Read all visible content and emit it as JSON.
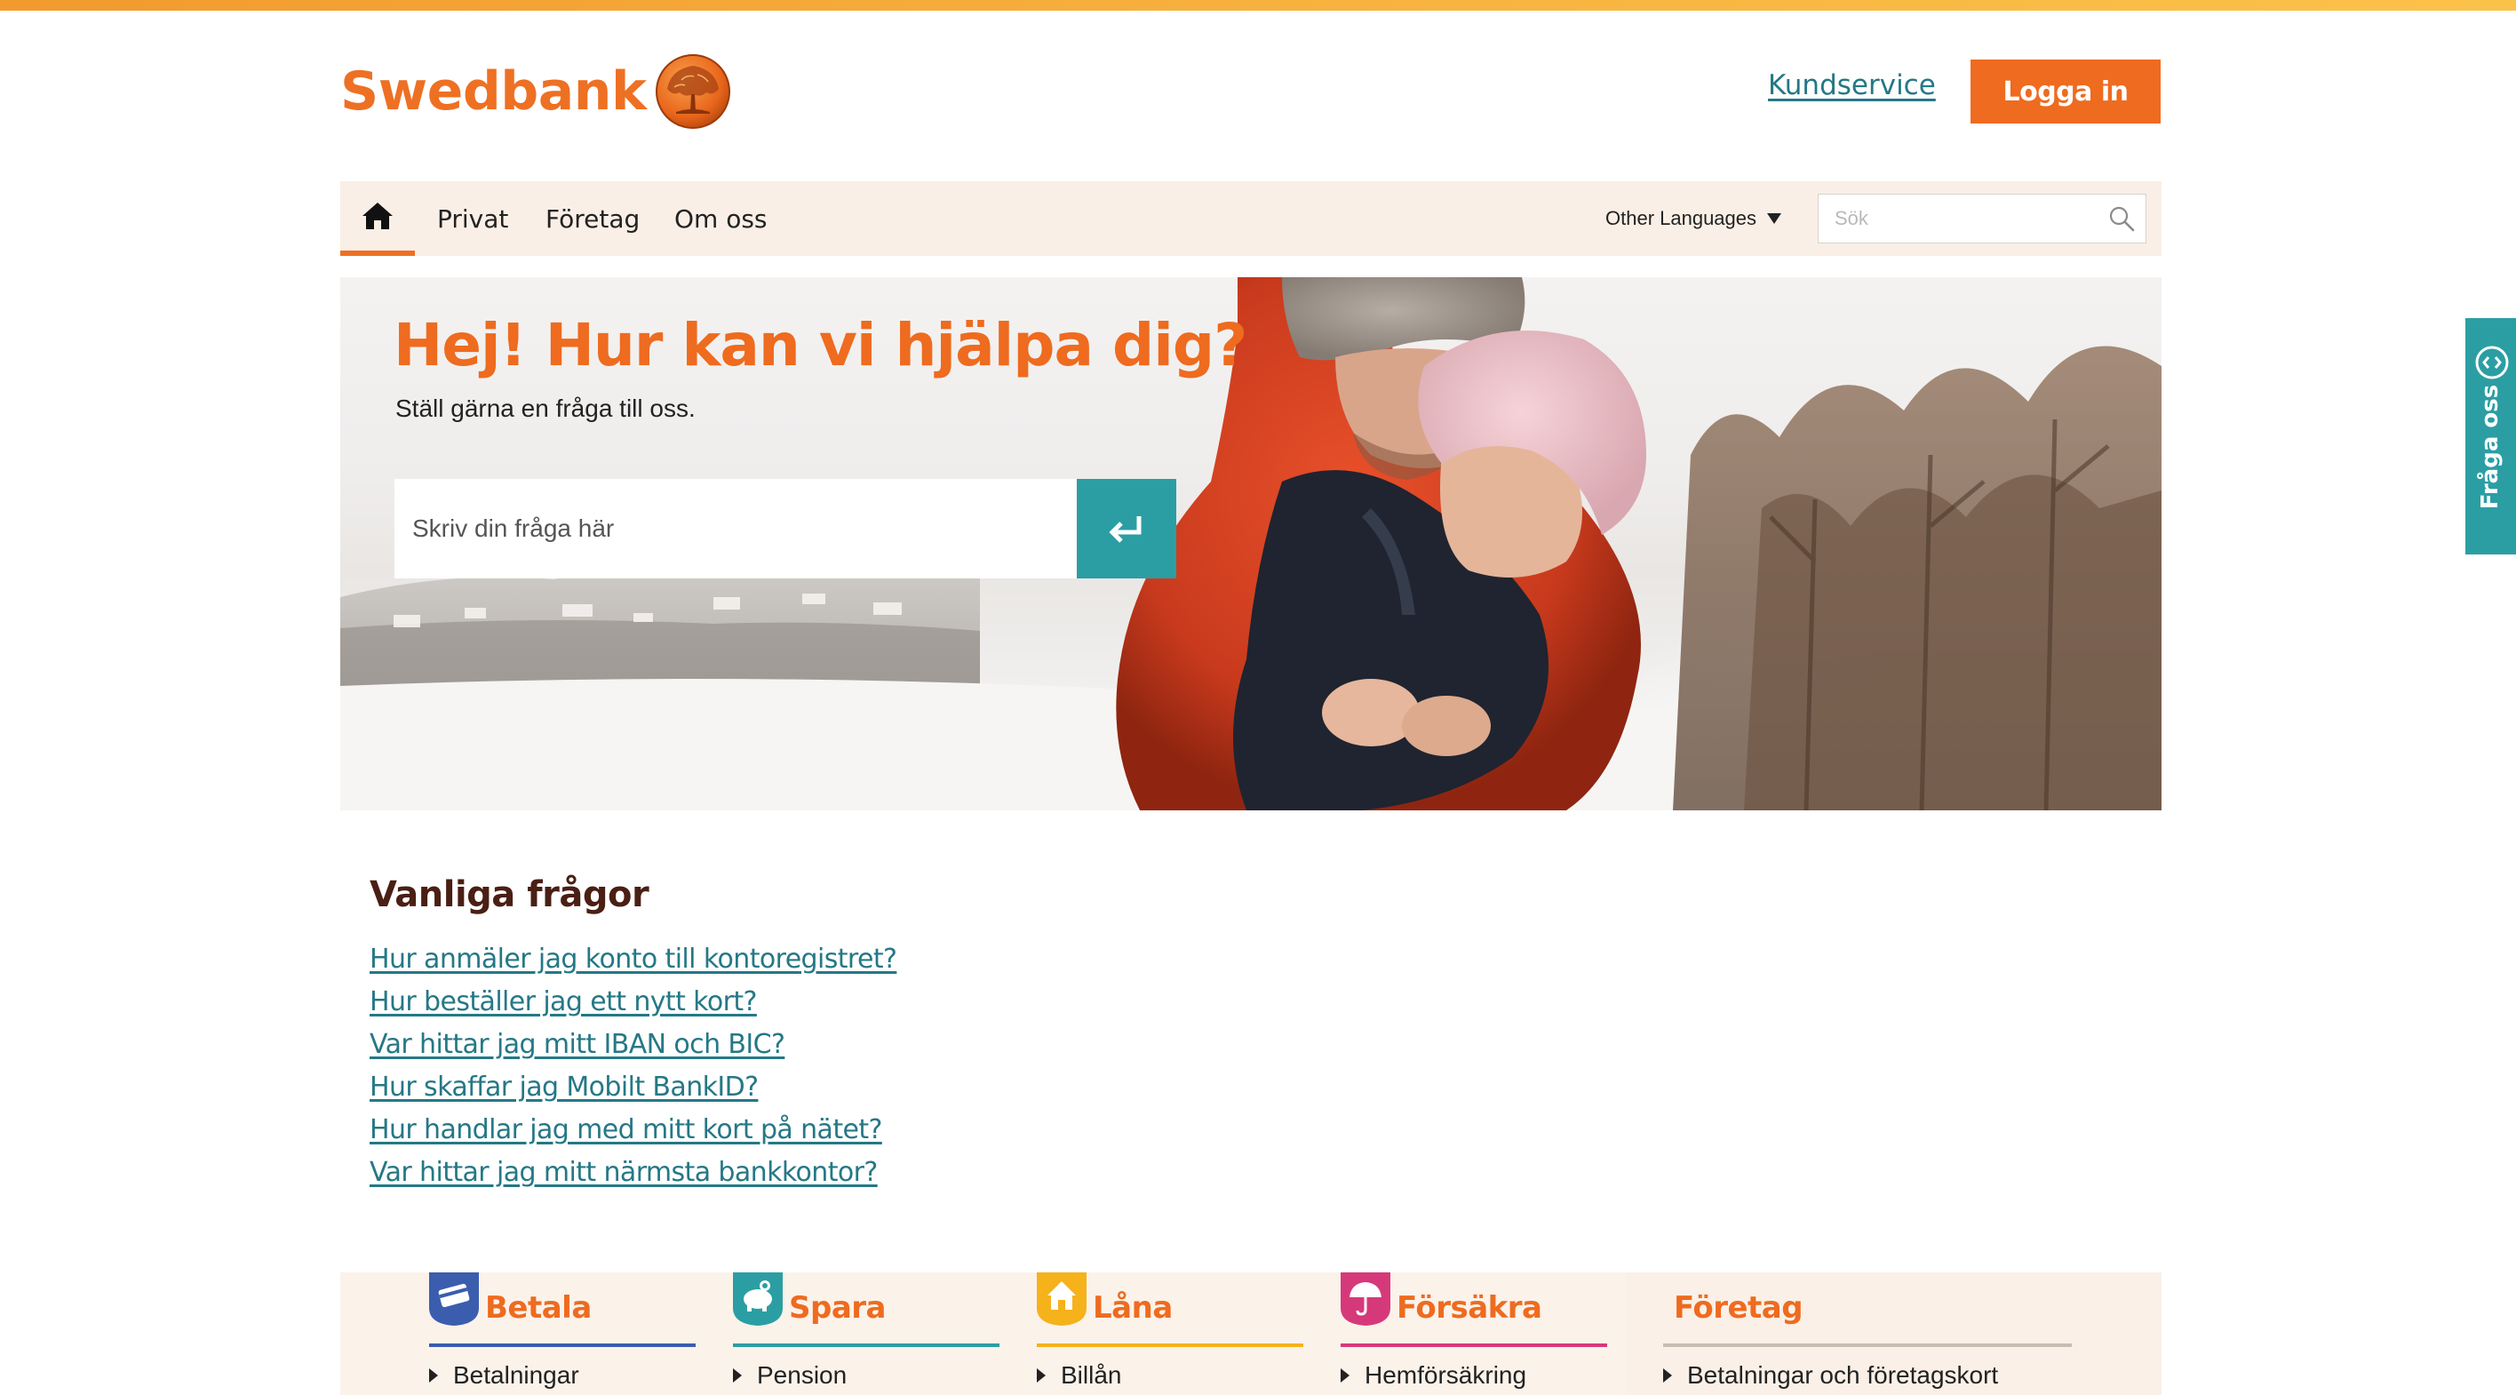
{
  "header": {
    "logo_text": "Swedbank",
    "kundservice_label": "Kundservice",
    "login_label": "Logga in",
    "brand_color": "#ee7023"
  },
  "nav": {
    "items": [
      {
        "label": "Privat"
      },
      {
        "label": "Företag"
      },
      {
        "label": "Om oss"
      }
    ],
    "language_label": "Other Languages",
    "search_placeholder": "Sök"
  },
  "hero": {
    "title": "Hej! Hur kan vi hjälpa dig?",
    "subtitle": "Ställ gärna en fråga till oss.",
    "search_placeholder": "Skriv din fråga här"
  },
  "side_tab": {
    "label": "Fråga oss"
  },
  "faq": {
    "heading": "Vanliga frågor",
    "items": [
      "Hur anmäler jag konto till kontoregistret?",
      "Hur beställer jag ett nytt kort?",
      "Var hittar jag mitt IBAN och BIC?",
      "Hur skaffar jag Mobilt BankID?",
      "Hur handlar jag med mitt kort på nätet?",
      "Var hittar jag mitt närmsta bankkontor?"
    ]
  },
  "categories": [
    {
      "title": "Betala",
      "link": "Betalningar",
      "color": "#3a5dae",
      "icon": "card-icon"
    },
    {
      "title": "Spara",
      "link": "Pension",
      "color": "#2b9ea4",
      "icon": "piggy-bank-icon"
    },
    {
      "title": "Låna",
      "link": "Billån",
      "color": "#f5b21a",
      "icon": "house-icon"
    },
    {
      "title": "Försäkra",
      "link": "Hemförsäkring",
      "color": "#d6397a",
      "icon": "umbrella-icon"
    },
    {
      "title": "Företag",
      "link": "Betalningar och företagskort",
      "color": "#c9bcb0",
      "icon": ""
    }
  ]
}
